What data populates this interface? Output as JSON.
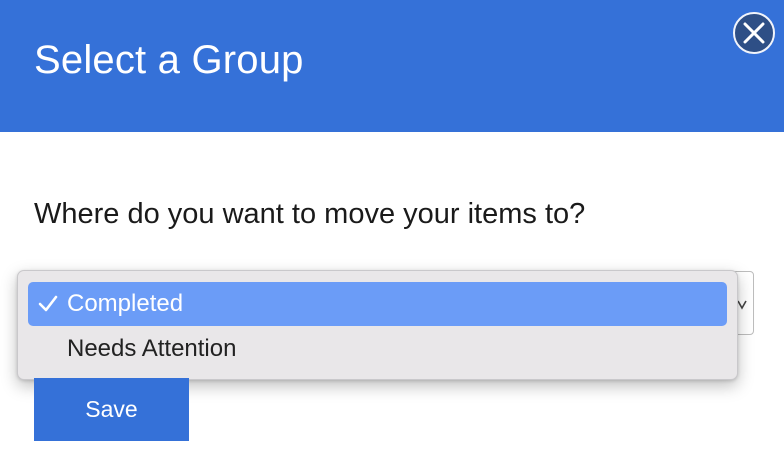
{
  "dialog": {
    "title": "Select a Group",
    "close_icon": "close-x-icon",
    "prompt": "Where do you want to move your items to?"
  },
  "group_select": {
    "selected_value": "Completed",
    "options": [
      {
        "label": "Completed",
        "selected": true,
        "check_icon": "checkmark-icon"
      },
      {
        "label": "Needs Attention",
        "selected": false
      }
    ],
    "chevron_icon": "chevron-down-icon"
  },
  "actions": {
    "save_label": "Save"
  },
  "colors": {
    "header_bg": "#3571d8",
    "close_bg": "#2e4f86",
    "selected_option_bg": "#6b9cf7",
    "dropdown_bg": "#e9e7e9",
    "save_bg": "#3571d8"
  }
}
